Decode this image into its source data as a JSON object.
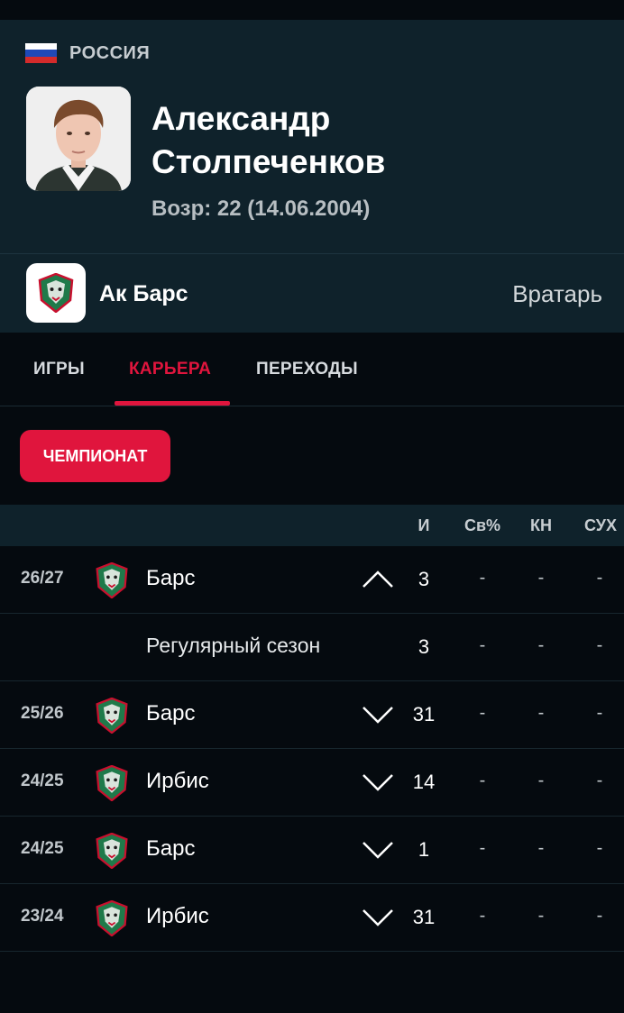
{
  "player": {
    "country": "РОССИЯ",
    "name_line1": "Александр",
    "name_line2": "Столпеченков",
    "age": "Возр: 22 (14.06.2004)",
    "team": "Ак Барс",
    "position": "Вратарь"
  },
  "tabs": [
    "ИГРЫ",
    "КАРЬЕРА",
    "ПЕРЕХОДЫ"
  ],
  "active_tab": "КАРЬЕРА",
  "filter": {
    "label": "ЧЕМПИОНАТ"
  },
  "table": {
    "headers": [
      "И",
      "Св%",
      "КН",
      "СУХ"
    ],
    "rows": [
      {
        "season": "26/27",
        "club": "Барс",
        "expanded": true,
        "games": "3",
        "sv": "-",
        "kn": "-",
        "suh": "-"
      },
      {
        "season": "",
        "club": "Регулярный сезон",
        "sub": true,
        "games": "3",
        "sv": "-",
        "kn": "-",
        "suh": "-"
      },
      {
        "season": "25/26",
        "club": "Барс",
        "expanded": false,
        "games": "31",
        "sv": "-",
        "kn": "-",
        "suh": "-"
      },
      {
        "season": "24/25",
        "club": "Ирбис",
        "expanded": false,
        "games": "14",
        "sv": "-",
        "kn": "-",
        "suh": "-"
      },
      {
        "season": "24/25",
        "club": "Барс",
        "expanded": false,
        "games": "1",
        "sv": "-",
        "kn": "-",
        "suh": "-"
      },
      {
        "season": "23/24",
        "club": "Ирбис",
        "expanded": false,
        "games": "31",
        "sv": "-",
        "kn": "-",
        "suh": "-"
      }
    ]
  },
  "colors": {
    "accent": "#e0153d",
    "header_bg": "#0f222b",
    "page_bg": "#050a0f"
  }
}
